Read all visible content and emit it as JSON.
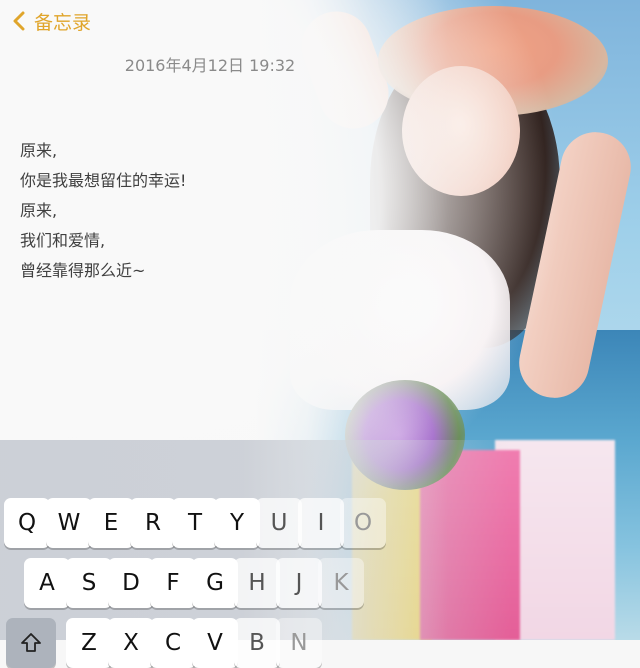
{
  "nav": {
    "back_label": "备忘录",
    "accent_color": "#e0a52b"
  },
  "note": {
    "date": "2016年4月12日 19:32",
    "lines": [
      "原来,",
      "你是我最想留住的幸运!",
      "原来,",
      "我们和爱情,",
      "曾经靠得那么近~"
    ]
  },
  "keyboard": {
    "row1": [
      "Q",
      "W",
      "E",
      "R",
      "T",
      "Y",
      "U",
      "I",
      "O"
    ],
    "row2": [
      "A",
      "S",
      "D",
      "F",
      "G",
      "H",
      "J",
      "K"
    ],
    "row3": [
      "Z",
      "X",
      "C",
      "V",
      "B",
      "N"
    ],
    "shift_icon": "shift-icon"
  }
}
